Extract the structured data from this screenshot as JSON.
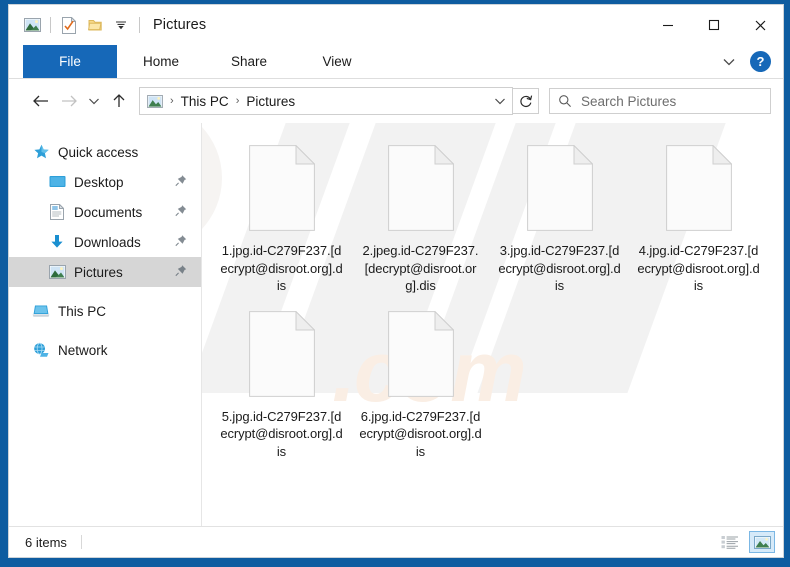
{
  "window": {
    "title": "Pictures",
    "quick_access_icons": [
      "pictures-icon",
      "properties-icon",
      "new-folder-icon",
      "customize-dropdown-icon"
    ],
    "controls": {
      "minimize": "minimize-button",
      "maximize": "maximize-button",
      "close": "close-button"
    }
  },
  "ribbon": {
    "tabs": [
      {
        "label": "File",
        "active": true
      },
      {
        "label": "Home",
        "active": false
      },
      {
        "label": "Share",
        "active": false
      },
      {
        "label": "View",
        "active": false
      }
    ],
    "expand_icon": "chevron-down-icon",
    "help_label": "?"
  },
  "address": {
    "back_icon": "back-arrow-icon",
    "forward_icon": "forward-arrow-icon",
    "recent_icon": "chevron-down-icon",
    "up_icon": "up-arrow-icon",
    "breadcrumb": [
      "This PC",
      "Pictures"
    ],
    "separator": "›",
    "dropdown_icon": "chevron-down-icon",
    "refresh_icon": "refresh-icon"
  },
  "search": {
    "placeholder": "Search Pictures",
    "icon": "search-icon"
  },
  "sidebar": {
    "items": [
      {
        "label": "Quick access",
        "icon": "star-icon",
        "child": false,
        "pinned": false,
        "selected": false
      },
      {
        "label": "Desktop",
        "icon": "desktop-icon",
        "child": true,
        "pinned": true,
        "selected": false
      },
      {
        "label": "Documents",
        "icon": "documents-icon",
        "child": true,
        "pinned": true,
        "selected": false
      },
      {
        "label": "Downloads",
        "icon": "downloads-icon",
        "child": true,
        "pinned": true,
        "selected": false
      },
      {
        "label": "Pictures",
        "icon": "pictures-icon",
        "child": true,
        "pinned": true,
        "selected": true
      },
      {
        "label": "This PC",
        "icon": "this-pc-icon",
        "child": false,
        "pinned": false,
        "selected": false
      },
      {
        "label": "Network",
        "icon": "network-icon",
        "child": false,
        "pinned": false,
        "selected": false
      }
    ]
  },
  "files": [
    {
      "name": "1.jpg.id-C279F237.[decrypt@disroot.org].dis",
      "icon": "blank-document-icon"
    },
    {
      "name": "2.jpeg.id-C279F237.[decrypt@disroot.org].dis",
      "icon": "blank-document-icon"
    },
    {
      "name": "3.jpg.id-C279F237.[decrypt@disroot.org].dis",
      "icon": "blank-document-icon"
    },
    {
      "name": "4.jpg.id-C279F237.[decrypt@disroot.org].dis",
      "icon": "blank-document-icon"
    },
    {
      "name": "5.jpg.id-C279F237.[decrypt@disroot.org].dis",
      "icon": "blank-document-icon"
    },
    {
      "name": "6.jpg.id-C279F237.[decrypt@disroot.org].dis",
      "icon": "blank-document-icon"
    }
  ],
  "status": {
    "item_count": "6 items",
    "details_view_icon": "details-view-icon",
    "large-icons_view_icon": "large-icons-view-icon"
  },
  "watermark": {
    "text": "risk.com"
  },
  "colors": {
    "frame": "#0e5ca0",
    "accent": "#1668b8",
    "selection": "#d6d6d6",
    "view_active": "#d6eaf9"
  }
}
